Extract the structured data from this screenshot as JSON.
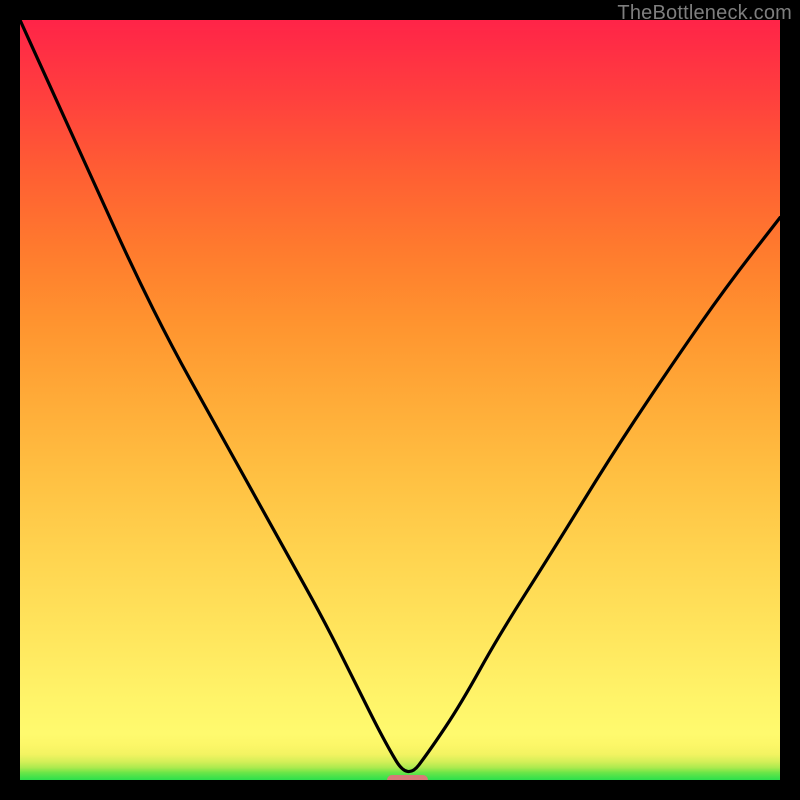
{
  "watermark": {
    "text": "TheBottleneck.com"
  },
  "colors": {
    "background": "#000000",
    "watermark": "#7e7e7e",
    "marker": "#d77a78",
    "curve": "#000000",
    "gradient_top": "#ff2448",
    "gradient_mid": "#ffe45c",
    "gradient_bottom": "#2be04c"
  },
  "chart_data": {
    "type": "line",
    "title": "",
    "xlabel": "",
    "ylabel": "",
    "xlim": [
      0,
      100
    ],
    "ylim": [
      0,
      100
    ],
    "grid": false,
    "legend": false,
    "annotations": [
      "TheBottleneck.com"
    ],
    "trough_x": 51,
    "trough_y": 0,
    "marker": {
      "x_center": 51,
      "y": 0,
      "width": 5.5,
      "height": 1.4
    },
    "series": [
      {
        "name": "bottleneck-curve",
        "x": [
          0,
          5,
          10,
          15,
          20,
          25,
          30,
          35,
          40,
          44,
          48,
          51,
          54,
          58,
          63,
          70,
          78,
          86,
          93,
          100
        ],
        "y": [
          100,
          89,
          78,
          67,
          57,
          48,
          39,
          30,
          21,
          13,
          5,
          0,
          4,
          10,
          19,
          30,
          43,
          55,
          65,
          74
        ]
      }
    ]
  }
}
